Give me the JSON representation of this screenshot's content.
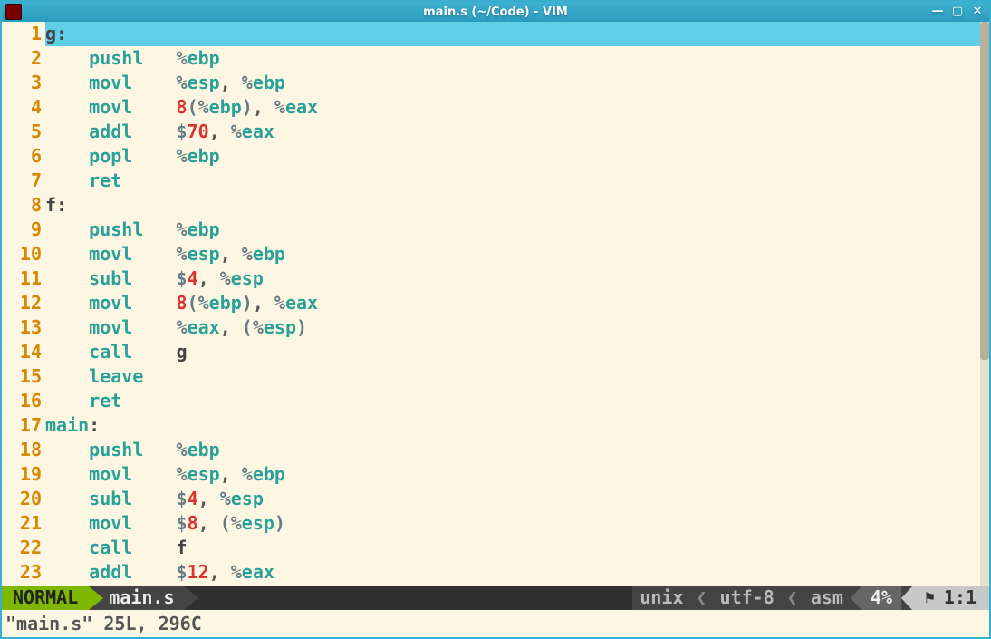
{
  "window": {
    "title": "main.s (~/Code) - VIM"
  },
  "lines": [
    {
      "n": 1,
      "indent": "",
      "highlight": true,
      "tokens": [
        {
          "t": "g",
          "c": "tok-plain"
        },
        {
          "t": ":",
          "c": "tok-plain"
        }
      ]
    },
    {
      "n": 2,
      "indent": "    ",
      "tokens": [
        {
          "t": "pushl",
          "c": "tok-instr"
        },
        {
          "t": "   ",
          "c": ""
        },
        {
          "t": "%",
          "c": "tok-punct"
        },
        {
          "t": "ebp",
          "c": "tok-reg"
        }
      ]
    },
    {
      "n": 3,
      "indent": "    ",
      "tokens": [
        {
          "t": "movl",
          "c": "tok-instr"
        },
        {
          "t": "    ",
          "c": ""
        },
        {
          "t": "%",
          "c": "tok-punct"
        },
        {
          "t": "esp",
          "c": "tok-reg"
        },
        {
          "t": ", ",
          "c": "tok-comma"
        },
        {
          "t": "%",
          "c": "tok-punct"
        },
        {
          "t": "ebp",
          "c": "tok-reg"
        }
      ]
    },
    {
      "n": 4,
      "indent": "    ",
      "tokens": [
        {
          "t": "movl",
          "c": "tok-instr"
        },
        {
          "t": "    ",
          "c": ""
        },
        {
          "t": "8",
          "c": "tok-num"
        },
        {
          "t": "(",
          "c": "tok-punct"
        },
        {
          "t": "%",
          "c": "tok-punct"
        },
        {
          "t": "ebp",
          "c": "tok-reg"
        },
        {
          "t": ")",
          "c": "tok-punct"
        },
        {
          "t": ", ",
          "c": "tok-comma"
        },
        {
          "t": "%",
          "c": "tok-punct"
        },
        {
          "t": "eax",
          "c": "tok-reg"
        }
      ]
    },
    {
      "n": 5,
      "indent": "    ",
      "tokens": [
        {
          "t": "addl",
          "c": "tok-instr"
        },
        {
          "t": "    ",
          "c": ""
        },
        {
          "t": "$",
          "c": "tok-punct"
        },
        {
          "t": "70",
          "c": "tok-num"
        },
        {
          "t": ", ",
          "c": "tok-comma"
        },
        {
          "t": "%",
          "c": "tok-punct"
        },
        {
          "t": "eax",
          "c": "tok-reg"
        }
      ]
    },
    {
      "n": 6,
      "indent": "    ",
      "tokens": [
        {
          "t": "popl",
          "c": "tok-instr"
        },
        {
          "t": "    ",
          "c": ""
        },
        {
          "t": "%",
          "c": "tok-punct"
        },
        {
          "t": "ebp",
          "c": "tok-reg"
        }
      ]
    },
    {
      "n": 7,
      "indent": "    ",
      "tokens": [
        {
          "t": "ret",
          "c": "tok-instr"
        }
      ]
    },
    {
      "n": 8,
      "indent": "",
      "tokens": [
        {
          "t": "f",
          "c": "tok-plain"
        },
        {
          "t": ":",
          "c": "tok-plain"
        }
      ]
    },
    {
      "n": 9,
      "indent": "    ",
      "tokens": [
        {
          "t": "pushl",
          "c": "tok-instr"
        },
        {
          "t": "   ",
          "c": ""
        },
        {
          "t": "%",
          "c": "tok-punct"
        },
        {
          "t": "ebp",
          "c": "tok-reg"
        }
      ]
    },
    {
      "n": 10,
      "indent": "    ",
      "tokens": [
        {
          "t": "movl",
          "c": "tok-instr"
        },
        {
          "t": "    ",
          "c": ""
        },
        {
          "t": "%",
          "c": "tok-punct"
        },
        {
          "t": "esp",
          "c": "tok-reg"
        },
        {
          "t": ", ",
          "c": "tok-comma"
        },
        {
          "t": "%",
          "c": "tok-punct"
        },
        {
          "t": "ebp",
          "c": "tok-reg"
        }
      ]
    },
    {
      "n": 11,
      "indent": "    ",
      "tokens": [
        {
          "t": "subl",
          "c": "tok-instr"
        },
        {
          "t": "    ",
          "c": ""
        },
        {
          "t": "$",
          "c": "tok-punct"
        },
        {
          "t": "4",
          "c": "tok-num"
        },
        {
          "t": ", ",
          "c": "tok-comma"
        },
        {
          "t": "%",
          "c": "tok-punct"
        },
        {
          "t": "esp",
          "c": "tok-reg"
        }
      ]
    },
    {
      "n": 12,
      "indent": "    ",
      "tokens": [
        {
          "t": "movl",
          "c": "tok-instr"
        },
        {
          "t": "    ",
          "c": ""
        },
        {
          "t": "8",
          "c": "tok-num"
        },
        {
          "t": "(",
          "c": "tok-punct"
        },
        {
          "t": "%",
          "c": "tok-punct"
        },
        {
          "t": "ebp",
          "c": "tok-reg"
        },
        {
          "t": ")",
          "c": "tok-punct"
        },
        {
          "t": ", ",
          "c": "tok-comma"
        },
        {
          "t": "%",
          "c": "tok-punct"
        },
        {
          "t": "eax",
          "c": "tok-reg"
        }
      ]
    },
    {
      "n": 13,
      "indent": "    ",
      "tokens": [
        {
          "t": "movl",
          "c": "tok-instr"
        },
        {
          "t": "    ",
          "c": ""
        },
        {
          "t": "%",
          "c": "tok-punct"
        },
        {
          "t": "eax",
          "c": "tok-reg"
        },
        {
          "t": ", ",
          "c": "tok-comma"
        },
        {
          "t": "(",
          "c": "tok-punct"
        },
        {
          "t": "%",
          "c": "tok-punct"
        },
        {
          "t": "esp",
          "c": "tok-reg"
        },
        {
          "t": ")",
          "c": "tok-punct"
        }
      ]
    },
    {
      "n": 14,
      "indent": "    ",
      "tokens": [
        {
          "t": "call",
          "c": "tok-instr"
        },
        {
          "t": "    ",
          "c": ""
        },
        {
          "t": "g",
          "c": "tok-plain"
        }
      ]
    },
    {
      "n": 15,
      "indent": "    ",
      "tokens": [
        {
          "t": "leave",
          "c": "tok-instr"
        }
      ]
    },
    {
      "n": 16,
      "indent": "    ",
      "tokens": [
        {
          "t": "ret",
          "c": "tok-instr"
        }
      ]
    },
    {
      "n": 17,
      "indent": "",
      "tokens": [
        {
          "t": "main",
          "c": "tok-label"
        },
        {
          "t": ":",
          "c": "tok-plain"
        }
      ]
    },
    {
      "n": 18,
      "indent": "    ",
      "tokens": [
        {
          "t": "pushl",
          "c": "tok-instr"
        },
        {
          "t": "   ",
          "c": ""
        },
        {
          "t": "%",
          "c": "tok-punct"
        },
        {
          "t": "ebp",
          "c": "tok-reg"
        }
      ]
    },
    {
      "n": 19,
      "indent": "    ",
      "tokens": [
        {
          "t": "movl",
          "c": "tok-instr"
        },
        {
          "t": "    ",
          "c": ""
        },
        {
          "t": "%",
          "c": "tok-punct"
        },
        {
          "t": "esp",
          "c": "tok-reg"
        },
        {
          "t": ", ",
          "c": "tok-comma"
        },
        {
          "t": "%",
          "c": "tok-punct"
        },
        {
          "t": "ebp",
          "c": "tok-reg"
        }
      ]
    },
    {
      "n": 20,
      "indent": "    ",
      "tokens": [
        {
          "t": "subl",
          "c": "tok-instr"
        },
        {
          "t": "    ",
          "c": ""
        },
        {
          "t": "$",
          "c": "tok-punct"
        },
        {
          "t": "4",
          "c": "tok-num"
        },
        {
          "t": ", ",
          "c": "tok-comma"
        },
        {
          "t": "%",
          "c": "tok-punct"
        },
        {
          "t": "esp",
          "c": "tok-reg"
        }
      ]
    },
    {
      "n": 21,
      "indent": "    ",
      "tokens": [
        {
          "t": "movl",
          "c": "tok-instr"
        },
        {
          "t": "    ",
          "c": ""
        },
        {
          "t": "$",
          "c": "tok-punct"
        },
        {
          "t": "8",
          "c": "tok-num"
        },
        {
          "t": ", ",
          "c": "tok-comma"
        },
        {
          "t": "(",
          "c": "tok-punct"
        },
        {
          "t": "%",
          "c": "tok-punct"
        },
        {
          "t": "esp",
          "c": "tok-reg"
        },
        {
          "t": ")",
          "c": "tok-punct"
        }
      ]
    },
    {
      "n": 22,
      "indent": "    ",
      "tokens": [
        {
          "t": "call",
          "c": "tok-instr"
        },
        {
          "t": "    ",
          "c": ""
        },
        {
          "t": "f",
          "c": "tok-plain"
        }
      ]
    },
    {
      "n": 23,
      "indent": "    ",
      "tokens": [
        {
          "t": "addl",
          "c": "tok-instr"
        },
        {
          "t": "    ",
          "c": ""
        },
        {
          "t": "$",
          "c": "tok-punct"
        },
        {
          "t": "12",
          "c": "tok-num"
        },
        {
          "t": ", ",
          "c": "tok-comma"
        },
        {
          "t": "%",
          "c": "tok-punct"
        },
        {
          "t": "eax",
          "c": "tok-reg"
        }
      ]
    }
  ],
  "status": {
    "mode": "NORMAL",
    "file": "main.s",
    "format": "unix",
    "encoding": "utf-8",
    "filetype": "asm",
    "percent": "4%",
    "position": "1:1"
  },
  "cmdline": "\"main.s\" 25L, 296C"
}
